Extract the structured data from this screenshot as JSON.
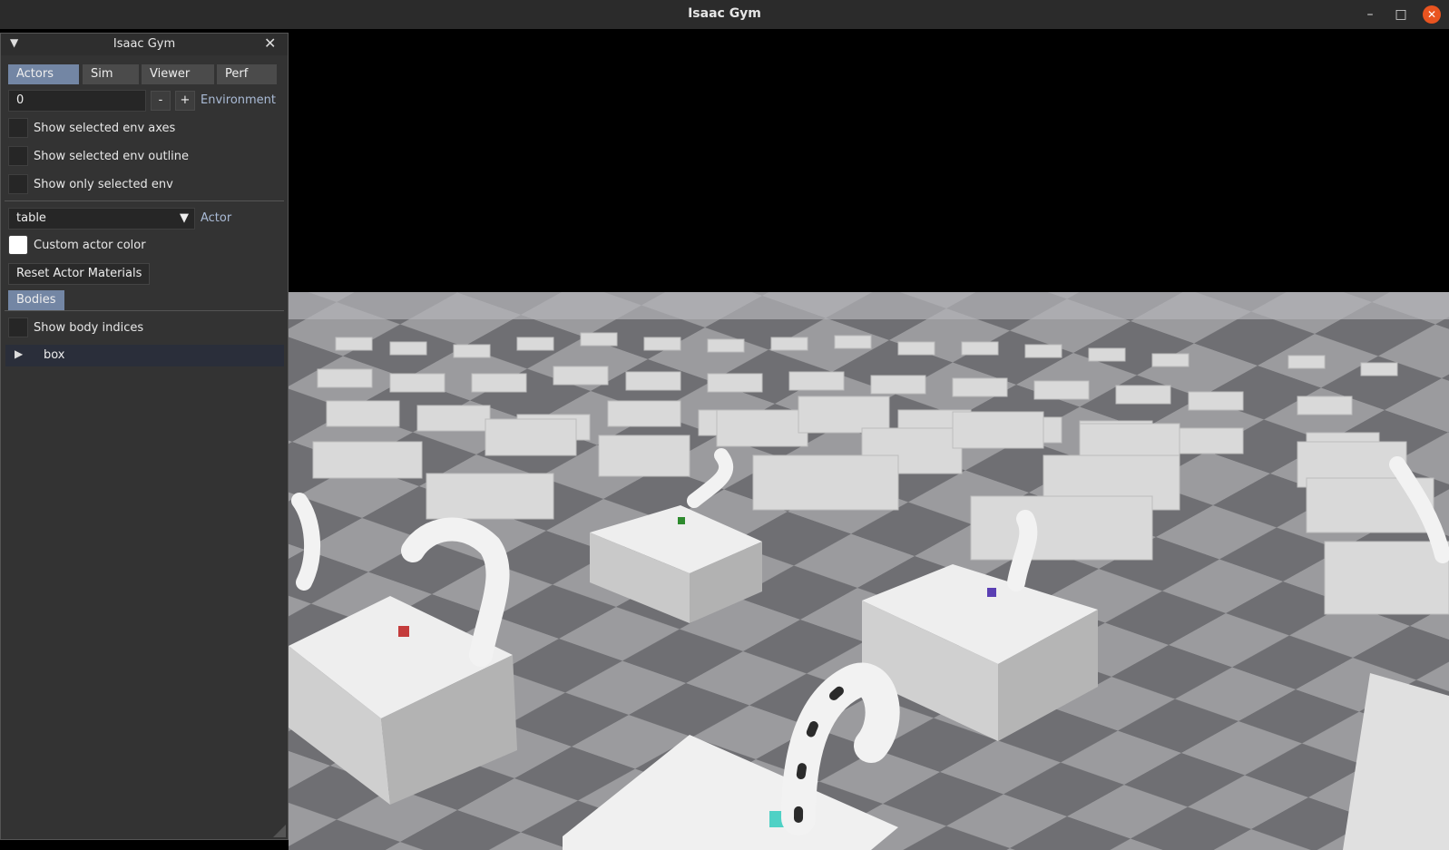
{
  "window": {
    "title": "Isaac Gym"
  },
  "panel": {
    "title": "Isaac Gym",
    "tabs": [
      "Actors",
      "Sim",
      "Viewer",
      "Perf"
    ],
    "env": {
      "value": "0",
      "minus": "-",
      "plus": "+",
      "label": "Environment"
    },
    "checks": [
      "Show selected env axes",
      "Show selected env outline",
      "Show only selected env"
    ],
    "actor": {
      "selected": "table",
      "label": "Actor"
    },
    "custom_color_label": "Custom actor color",
    "reset_button": "Reset Actor Materials",
    "bodies_tab": "Bodies",
    "show_body_indices": "Show body indices",
    "tree_item": "box"
  },
  "colors": {
    "accent": "#7386a4",
    "label": "#aabbd6",
    "close": "#e95420"
  }
}
